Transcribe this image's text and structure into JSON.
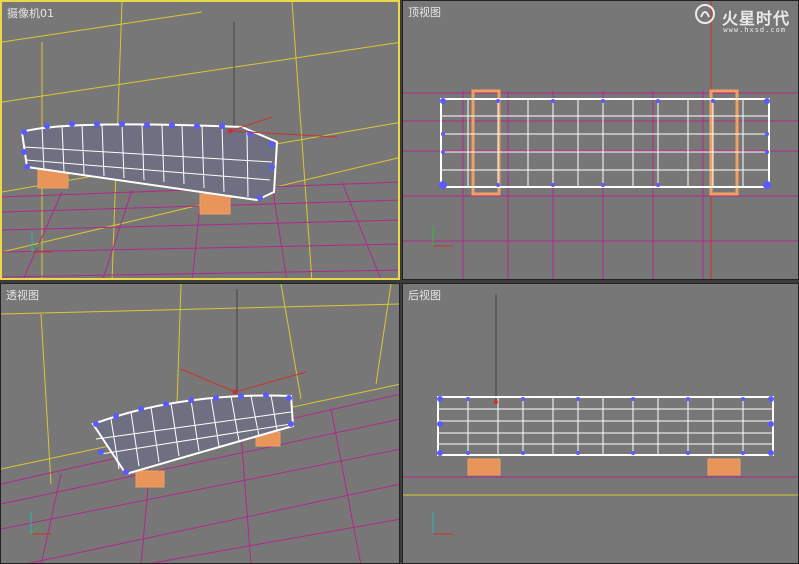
{
  "viewports": {
    "camera": {
      "label": "摄像机01",
      "active": true
    },
    "top": {
      "label": "顶视图",
      "active": false
    },
    "perspective": {
      "label": "透视图",
      "active": false
    },
    "back": {
      "label": "后视图",
      "active": false
    }
  },
  "watermark": {
    "main": "火星时代",
    "sub": "www.hxsd.com"
  },
  "colors": {
    "viewport_bg": "#777777",
    "active_border": "#e8d84a",
    "grid": "#b0288c",
    "wall_lines": "#d8c830",
    "mesh": "#ffffff",
    "vertex": "#5a5aff",
    "selected_mesh": "#f0a060",
    "gizmo": "#c83232"
  },
  "icons": [
    "axis-tripod-icon",
    "move-gizmo-icon",
    "watermark-logo-icon"
  ]
}
